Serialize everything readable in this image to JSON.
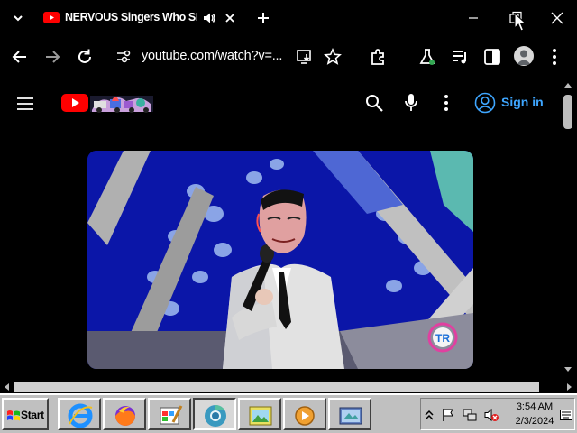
{
  "tab": {
    "title": "NERVOUS Singers Who SH",
    "favicon": "youtube-icon",
    "audio_icon": "speaker-icon"
  },
  "toolbar": {
    "url": "youtube.com/watch?v=...",
    "icons": [
      "back-icon",
      "forward-icon",
      "reload-icon",
      "site-info-icon",
      "install-app-icon",
      "star-icon",
      "extensions-icon",
      "labs-icon",
      "media-control-icon",
      "side-panel-icon",
      "profile-icon",
      "more-menu-icon"
    ]
  },
  "youtube": {
    "sign_in_label": "Sign in",
    "video_watermark": "TR"
  },
  "taskbar": {
    "start_label": "Start",
    "time": "3:54 AM",
    "date": "2/3/2024",
    "apps": [
      "internet-explorer-icon",
      "firefox-icon",
      "paint-icon",
      "chrome-icon",
      "picture-viewer-icon",
      "media-player-icon",
      "file-explorer-icon"
    ]
  },
  "colors": {
    "youtube_red": "#ff0000",
    "sign_in_blue": "#3ea6ff",
    "taskbar_gray": "#c0c0c0",
    "page_background": "#000000"
  }
}
